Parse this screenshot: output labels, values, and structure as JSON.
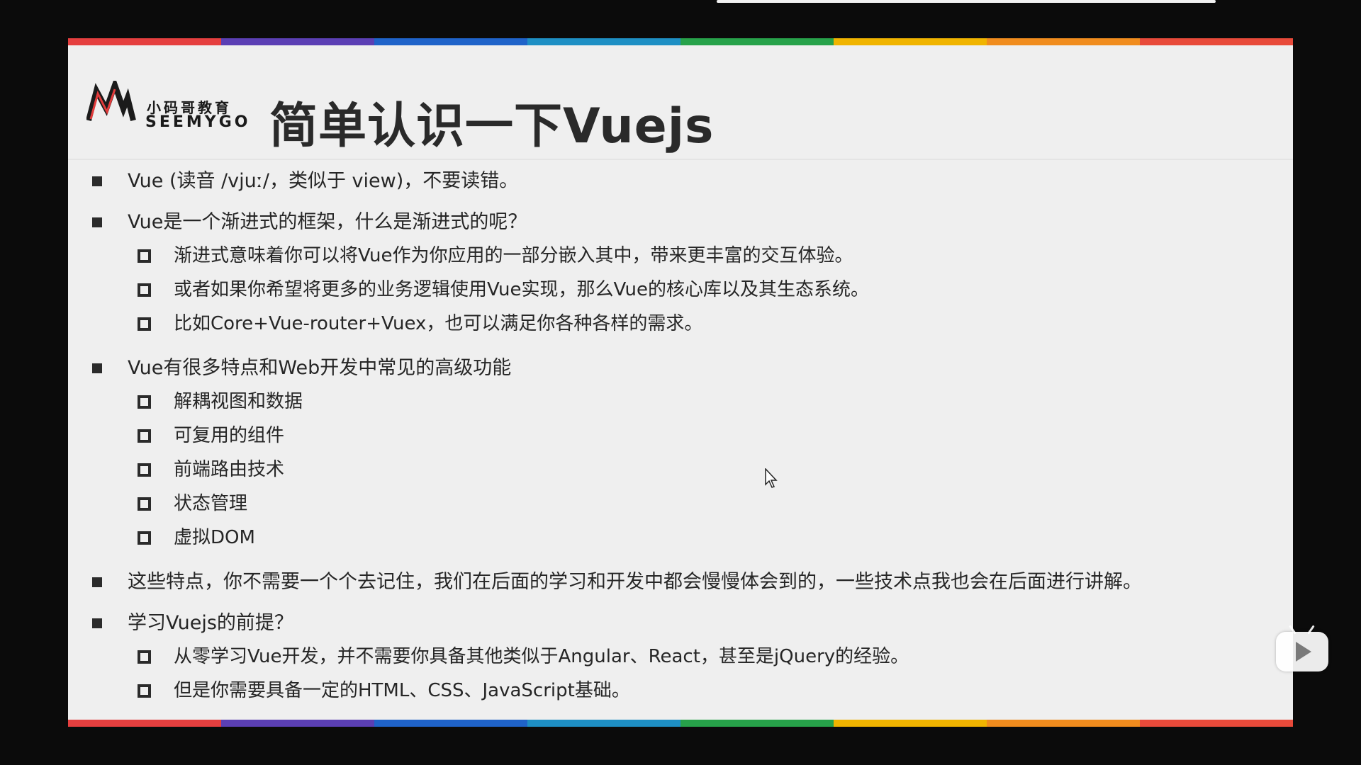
{
  "slide": {
    "title": "简单认识一下Vuejs",
    "logo": {
      "cn": "小码哥教育",
      "en": "SEEMYGO"
    },
    "stripe_colors": [
      "#e53f3f",
      "#5b3fb4",
      "#1f63c9",
      "#1e8fc4",
      "#27a24a",
      "#f0b400",
      "#f08c1e",
      "#e84a3a"
    ],
    "items": [
      {
        "level": 1,
        "text": "Vue (读音 /vjuː/，类似于 view)，不要读错。"
      },
      {
        "level": 1,
        "text": "Vue是一个渐进式的框架，什么是渐进式的呢？"
      },
      {
        "level": 2,
        "text": "渐进式意味着你可以将Vue作为你应用的一部分嵌入其中，带来更丰富的交互体验。"
      },
      {
        "level": 2,
        "text": "或者如果你希望将更多的业务逻辑使用Vue实现，那么Vue的核心库以及其生态系统。"
      },
      {
        "level": 2,
        "text": "比如Core+Vue-router+Vuex，也可以满足你各种各样的需求。"
      },
      {
        "level": 1,
        "text": "Vue有很多特点和Web开发中常见的高级功能"
      },
      {
        "level": 2,
        "text": "解耦视图和数据"
      },
      {
        "level": 2,
        "text": "可复用的组件"
      },
      {
        "level": 2,
        "text": "前端路由技术"
      },
      {
        "level": 2,
        "text": "状态管理"
      },
      {
        "level": 2,
        "text": "虚拟DOM"
      },
      {
        "level": 1,
        "text": "这些特点，你不需要一个个去记住，我们在后面的学习和开发中都会慢慢体会到的，一些技术点我也会在后面进行讲解。"
      },
      {
        "level": 1,
        "text": "学习Vuejs的前提？"
      },
      {
        "level": 2,
        "text": "从零学习Vue开发，并不需要你具备其他类似于Angular、React，甚至是jQuery的经验。"
      },
      {
        "level": 2,
        "text": "但是你需要具备一定的HTML、CSS、JavaScript基础。"
      }
    ]
  },
  "player": {
    "play_icon": "play-icon",
    "cursor_icon": "mouse-pointer-icon"
  }
}
